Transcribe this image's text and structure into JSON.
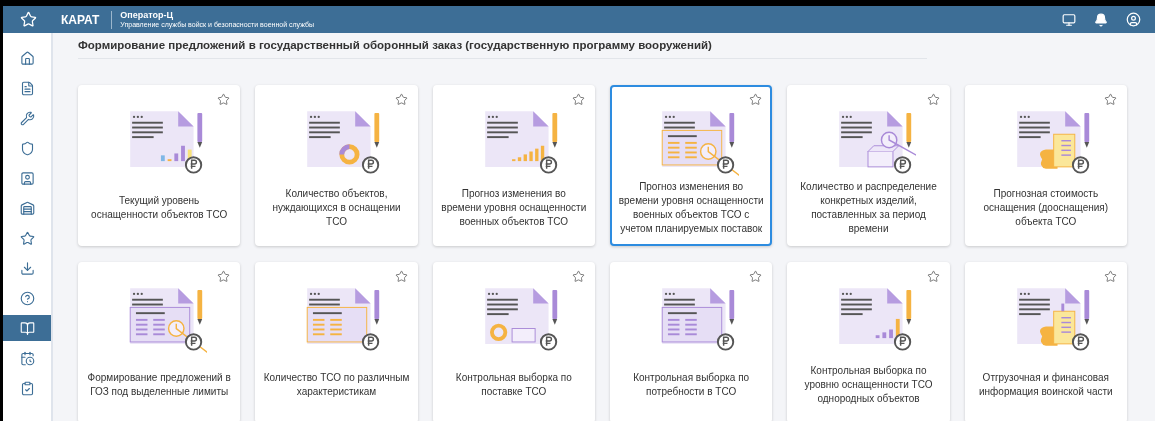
{
  "header": {
    "logo": "КАРАТ",
    "app_title": "Оператор-Ц",
    "app_subtitle": "Управление службы войск и безопасности военной службы"
  },
  "sidebar": {
    "items": [
      {
        "kind": "home",
        "selected": false
      },
      {
        "kind": "document",
        "selected": false
      },
      {
        "kind": "wrench",
        "selected": false
      },
      {
        "kind": "shield",
        "selected": false
      },
      {
        "kind": "person-card",
        "selected": false
      },
      {
        "kind": "warehouse",
        "selected": false
      },
      {
        "kind": "star",
        "selected": false
      },
      {
        "kind": "download",
        "selected": false
      },
      {
        "kind": "help",
        "selected": false
      },
      {
        "kind": "book",
        "selected": true
      },
      {
        "kind": "calendar",
        "selected": false
      },
      {
        "kind": "clipboard",
        "selected": false
      }
    ]
  },
  "page_title": "Формирование предложений в государственный оборонный заказ (государственную программу вооружений)",
  "cards": [
    {
      "title": "Текущий уровень оснащенности объектов ТСО",
      "kind": "bars",
      "selected": false
    },
    {
      "title": "Количество объектов, нуждающихся в оснащении ТСО",
      "kind": "donut",
      "selected": false
    },
    {
      "title": "Прогноз изменения во времени уровня оснащенности военных объектов ТСО",
      "kind": "rising",
      "selected": false
    },
    {
      "title": "Прогноз изменения во времени уровня оснащенности военных объектов ТСО с учетом планируемых поставок",
      "kind": "table-clock",
      "selected": true
    },
    {
      "title": "Количество и распределение конкретных изделий, поставленных за период времени",
      "kind": "box-clock",
      "selected": false
    },
    {
      "title": "Прогнозная стоимость оснащения (дооснащения) объекта ТСО",
      "kind": "receipt",
      "selected": false
    },
    {
      "title": "Формирование предложений в ГОЗ под выделенные лимиты",
      "kind": "table-clock-orange",
      "selected": false
    },
    {
      "title": "Количество ТСО по различным характеристикам",
      "kind": "table",
      "selected": false
    },
    {
      "title": "Контрольная выборка по поставке ТСО",
      "kind": "donut-box",
      "selected": false
    },
    {
      "title": "Контрольная выборка по потребности в ТСО",
      "kind": "table-purple",
      "selected": false
    },
    {
      "title": "Контрольная выборка по уровню оснащенности ТСО однородных объектов",
      "kind": "bars-small",
      "selected": false
    },
    {
      "title": "Отгрузочная и финансовая информация воинской части",
      "kind": "receipt-info",
      "selected": false
    }
  ]
}
